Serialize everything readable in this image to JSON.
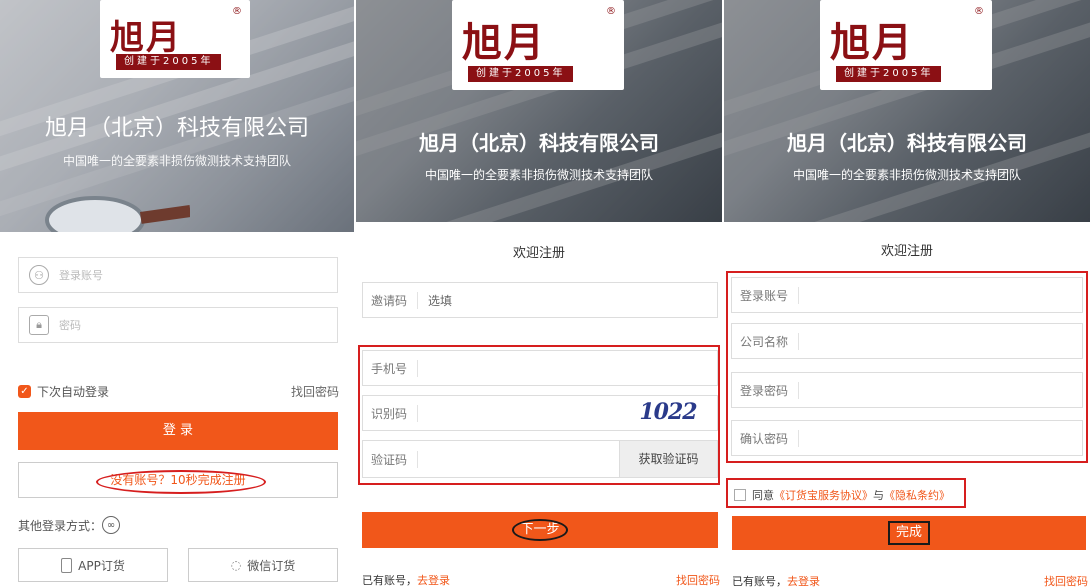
{
  "brand": {
    "logo_text": "旭月",
    "registered": "®",
    "since": "创建于2005年",
    "company": "旭月（北京）科技有限公司",
    "slogan": "中国唯一的全要素非损伤微测技术支持团队"
  },
  "login": {
    "account_placeholder": "登录账号",
    "password_placeholder": "密码",
    "remember": "下次自动登录",
    "forgot": "找回密码",
    "login_button": "登 录",
    "register_prompt": "没有账号？10秒完成注册",
    "other_login": "其他登录方式：",
    "app_order": "APP订货",
    "wechat_order": "微信订货"
  },
  "register_step1": {
    "title": "欢迎注册",
    "invite_label": "邀请码",
    "invite_value": "选填",
    "phone_label": "手机号",
    "captcha_label": "识别码",
    "captcha_text": "1022",
    "sms_label": "验证码",
    "sms_button": "获取验证码",
    "next_button": "下一步",
    "have_account": "已有账号，",
    "go_login": "去登录",
    "forgot": "找回密码"
  },
  "register_step2": {
    "title": "欢迎注册",
    "account_label": "登录账号",
    "company_label": "公司名称",
    "password_label": "登录密码",
    "confirm_label": "确认密码",
    "agree_prefix": "同意",
    "agreement": "《订货宝服务协议》",
    "and": "与",
    "privacy": "《隐私条约》",
    "finish_button": "完成",
    "have_account": "已有账号，",
    "go_login": "去登录",
    "forgot": "找回密码"
  }
}
